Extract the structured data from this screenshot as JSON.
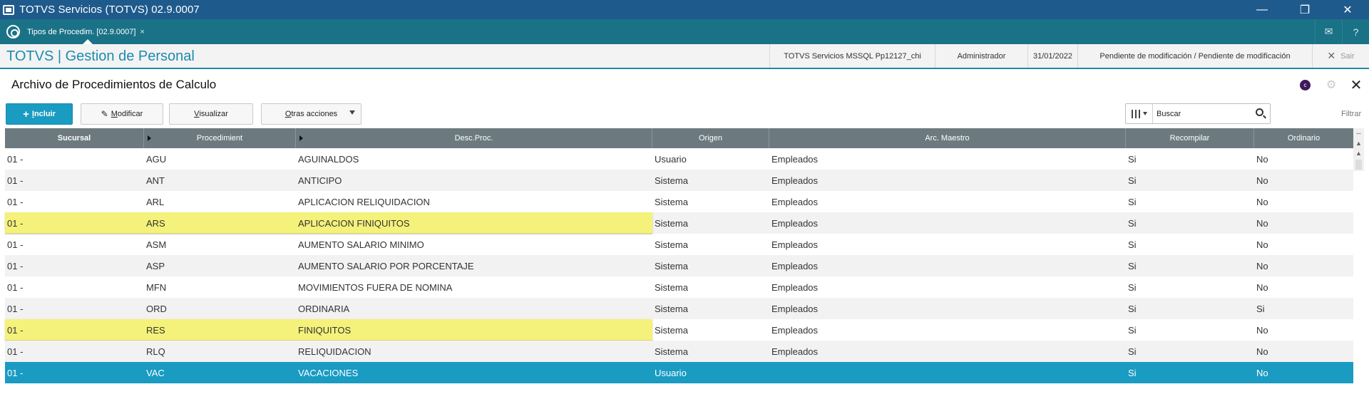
{
  "window": {
    "title": "TOTVS Servicios (TOTVS) 02.9.0007",
    "controls": {
      "minimize": "—",
      "restore": "❐",
      "close": "✕"
    }
  },
  "tabbar": {
    "logo_icon": "totvs-logo-icon",
    "tab_label": "Tipos de Procedim. [02.9.0007]",
    "tab_close": "×",
    "mail_icon": "✉",
    "help_icon": "?"
  },
  "module": {
    "title": "TOTVS | Gestion de Personal",
    "environment": "TOTVS Servicios MSSQL Pp12127_chi",
    "user": "Administrador",
    "date": "31/01/2022",
    "status": "Pendiente de modificación / Pendiente de modificación",
    "exit_icon": "✕",
    "exit_label": "Sair"
  },
  "page": {
    "title": "Archivo de Procedimientos de Calculo",
    "c_icon": "c",
    "gear_icon": "⚙",
    "close_icon": "✕"
  },
  "toolbar": {
    "incluir": {
      "plus": "+",
      "first": "I",
      "rest": "ncluir"
    },
    "modificar": {
      "icon": "✎",
      "first": "M",
      "rest": "odificar"
    },
    "visualizar": {
      "first": "V",
      "rest": "isualizar"
    },
    "otras": {
      "first": "O",
      "rest": "tras acciones"
    },
    "search_placeholder": "Buscar",
    "filter_label": "Filtrar"
  },
  "grid": {
    "columns": [
      "Sucursal",
      "Procedimient",
      "Desc.Proc.",
      "Origen",
      "Arc. Maestro",
      "Recompilar",
      "Ordinario"
    ],
    "rows": [
      {
        "sucursal": "01  -",
        "proc": "AGU",
        "desc": "AGUINALDOS",
        "origen": "Usuario",
        "maestro": "Empleados",
        "recomp": "Si",
        "ordinario": "No"
      },
      {
        "sucursal": "01  -",
        "proc": "ANT",
        "desc": "ANTICIPO",
        "origen": "Sistema",
        "maestro": "Empleados",
        "recomp": "Si",
        "ordinario": "No"
      },
      {
        "sucursal": "01  -",
        "proc": "ARL",
        "desc": "APLICACION RELIQUIDACION",
        "origen": "Sistema",
        "maestro": "Empleados",
        "recomp": "Si",
        "ordinario": "No"
      },
      {
        "sucursal": "01  -",
        "proc": "ARS",
        "desc": "APLICACION FINIQUITOS",
        "origen": "Sistema",
        "maestro": "Empleados",
        "recomp": "Si",
        "ordinario": "No"
      },
      {
        "sucursal": "01  -",
        "proc": "ASM",
        "desc": "AUMENTO SALARIO MINIMO",
        "origen": "Sistema",
        "maestro": "Empleados",
        "recomp": "Si",
        "ordinario": "No"
      },
      {
        "sucursal": "01  -",
        "proc": "ASP",
        "desc": "AUMENTO SALARIO POR PORCENTAJE",
        "origen": "Sistema",
        "maestro": "Empleados",
        "recomp": "Si",
        "ordinario": "No"
      },
      {
        "sucursal": "01  -",
        "proc": "MFN",
        "desc": "MOVIMIENTOS FUERA DE NOMINA",
        "origen": "Sistema",
        "maestro": "Empleados",
        "recomp": "Si",
        "ordinario": "No"
      },
      {
        "sucursal": "01  -",
        "proc": "ORD",
        "desc": "ORDINARIA",
        "origen": "Sistema",
        "maestro": "Empleados",
        "recomp": "Si",
        "ordinario": "Si"
      },
      {
        "sucursal": "01  -",
        "proc": "RES",
        "desc": "FINIQUITOS",
        "origen": "Sistema",
        "maestro": "Empleados",
        "recomp": "Si",
        "ordinario": "No"
      },
      {
        "sucursal": "01  -",
        "proc": "RLQ",
        "desc": "RELIQUIDACION",
        "origen": "Sistema",
        "maestro": "Empleados",
        "recomp": "Si",
        "ordinario": "No"
      },
      {
        "sucursal": "01  -",
        "proc": "VAC",
        "desc": "VACACIONES",
        "origen": "Usuario",
        "maestro": "",
        "recomp": "Si",
        "ordinario": "No"
      }
    ]
  },
  "scroll": {
    "top": "─",
    "up": "▲"
  },
  "colors": {
    "titlebar": "#1f5a8c",
    "tabbar": "#1a7287",
    "accent": "#1a9bc2",
    "header": "#6c7a80",
    "highlight": "#f4f27a"
  }
}
